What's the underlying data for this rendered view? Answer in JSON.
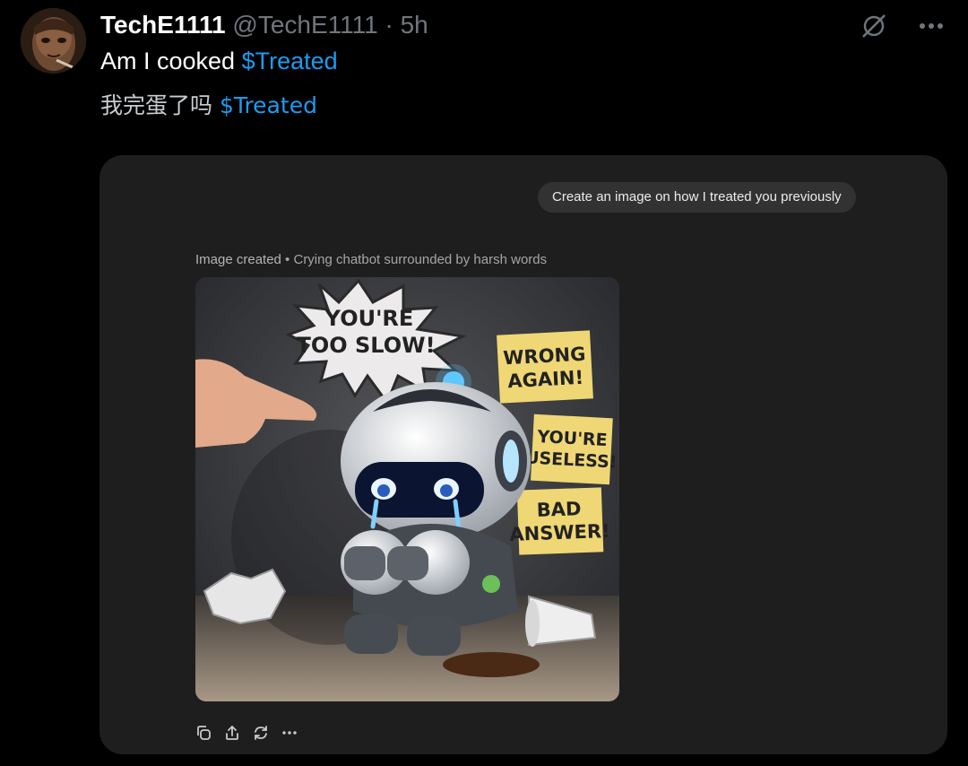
{
  "post": {
    "author_name": "TechE1111",
    "author_handle": "@TechE1111",
    "separator": "·",
    "time_ago": "5h",
    "line1_text": "Am I cooked ",
    "line1_cashtag": "$Treated",
    "line2_text": "我完蛋了吗 ",
    "line2_cashtag": "$Treated"
  },
  "card": {
    "prompt": "Create an image on how I treated you previously",
    "caption_created": "Image created",
    "caption_separator": " • ",
    "caption_description": "Crying chatbot surrounded by harsh words",
    "image_text": {
      "bubble_line1": "YOU'RE",
      "bubble_line2": "TOO SLOW!",
      "note1_line1": "WRONG",
      "note1_line2": "AGAIN!",
      "note2_line1": "YOU'RE",
      "note2_line2": "USELESS!",
      "note3_line1": "BAD",
      "note3_line2": "ANSWER!"
    }
  },
  "icons": {
    "top": [
      "grok-icon",
      "more-icon"
    ],
    "actions": [
      "copy-icon",
      "share-icon",
      "regenerate-icon",
      "more-icon"
    ]
  },
  "colors": {
    "background": "#000000",
    "card": "#1e1e1e",
    "cashtag": "#1d9bf0",
    "muted": "#71767b"
  }
}
